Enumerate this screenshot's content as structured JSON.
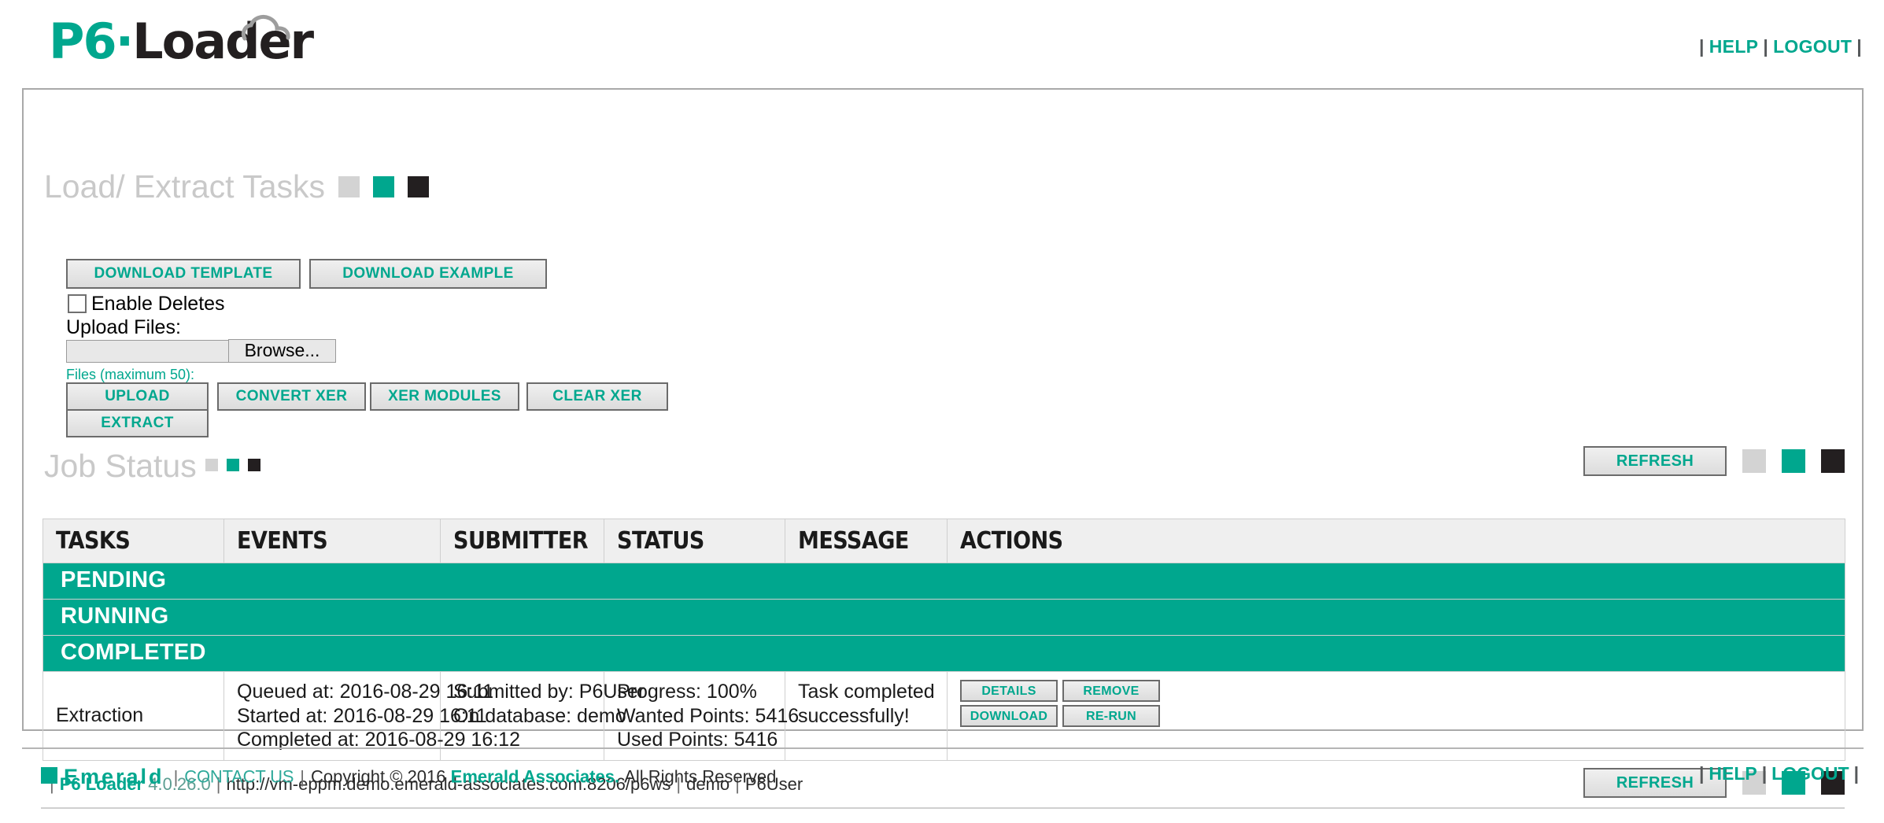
{
  "header": {
    "logo": {
      "prefix": "P6",
      "separator": "·",
      "suffix": "Loader",
      "cloud_icon": "cloud-icon"
    },
    "nav": {
      "bar1": "|",
      "help": "HELP",
      "bar2": "|",
      "logout": "LOGOUT",
      "bar3": "|"
    }
  },
  "load_section": {
    "title": "Load/ Extract Tasks",
    "download_template": "DOWNLOAD TEMPLATE",
    "download_example": "DOWNLOAD EXAMPLE",
    "enable_deletes_label": "Enable Deletes",
    "enable_deletes_checked": false,
    "upload_files_label": "Upload Files:",
    "file_input_value": "",
    "browse_label": "Browse...",
    "files_max_label": "Files (maximum 50):",
    "upload": "UPLOAD",
    "convert_xer": "CONVERT XER",
    "xer_modules": "XER MODULES",
    "clear_xer": "CLEAR XER",
    "extract": "EXTRACT"
  },
  "job_section": {
    "title": "Job Status",
    "refresh": "REFRESH",
    "refresh_bottom": "REFRESH"
  },
  "table": {
    "columns": [
      "TASKS",
      "EVENTS",
      "SUBMITTER",
      "STATUS",
      "MESSAGE",
      "ACTIONS"
    ],
    "groups": [
      {
        "label": "PENDING",
        "rows": []
      },
      {
        "label": "RUNNING",
        "rows": []
      },
      {
        "label": "COMPLETED",
        "rows": [
          {
            "task": "Extraction",
            "events": [
              "Queued at: 2016-08-29 16:11",
              "Started at: 2016-08-29 16:11",
              "Completed at: 2016-08-29 16:12"
            ],
            "submitter": [
              "Submitted by: P6User",
              "On database: demo"
            ],
            "status": [
              "Progress: 100%",
              "Wanted Points: 5416",
              "Used Points: 5416"
            ],
            "message": [
              "Task completed",
              "successfully!"
            ],
            "actions": [
              "DETAILS",
              "REMOVE",
              "DOWNLOAD",
              "RE-RUN"
            ]
          }
        ]
      }
    ]
  },
  "statusbar": {
    "bar1": "|",
    "app": "P6 Loader",
    "version": "4.0.26.0",
    "bar2": "|",
    "url": "http://vm-eppm.demo.emerald-associates.com:8206/p6ws",
    "bar3": "|",
    "database": "demo",
    "bar4": "|",
    "user": "P6User"
  },
  "footer": {
    "brand": "Emerald",
    "sep1": "|",
    "contact": "CONTACT US",
    "sep2": "|",
    "copyright": "Copyright © 2016",
    "company": "Emerald Associates.",
    "rights": "All Rights Reserved",
    "nav": {
      "bar1": "|",
      "help": "HELP",
      "bar2": "|",
      "logout": "LOGOUT",
      "bar3": "|"
    }
  },
  "colors": {
    "teal": "#00A78E",
    "dark": "#231F20",
    "grey_square": "#d3d3d3",
    "heading_grey": "#c9c9c9",
    "panel_border": "#a9a9a9"
  }
}
